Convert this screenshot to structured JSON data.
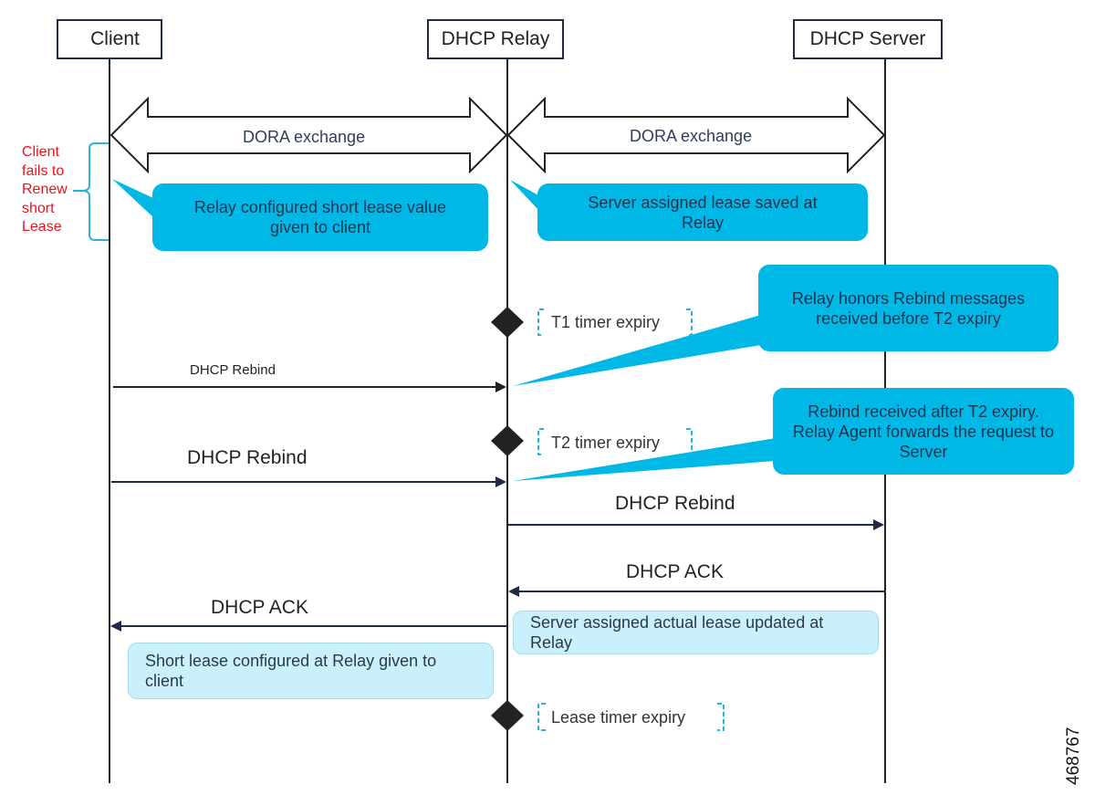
{
  "actors": {
    "client": "Client",
    "relay": "DHCP Relay",
    "server": "DHCP Server"
  },
  "exchanges": {
    "client_relay": "DORA exchange",
    "relay_server": "DORA exchange"
  },
  "side_note": {
    "lines": [
      "Client",
      "fails to",
      "Renew",
      "short",
      "Lease"
    ],
    "color": "#e8141b"
  },
  "callouts": {
    "relay_short_lease": "Relay configured short lease value given to client",
    "server_lease_saved": "Server assigned lease saved at Relay",
    "relay_honors_rebind": "Relay honors Rebind messages received before T2 expiry",
    "rebind_after_t2": "Rebind received after T2 expiry. Relay Agent forwards the request to Server",
    "server_lease_updated": "Server assigned actual lease updated at Relay",
    "short_lease_given": "Short lease configured at Relay given to client"
  },
  "timers": {
    "t1": "T1 timer expiry",
    "t2": "T2 timer expiry",
    "lease": "Lease timer expiry"
  },
  "messages": [
    {
      "label": "DHCP Rebind",
      "from": "Client",
      "to": "DHCP Relay"
    },
    {
      "label": "DHCP Rebind",
      "from": "Client",
      "to": "DHCP Relay"
    },
    {
      "label": "DHCP Rebind",
      "from": "DHCP Relay",
      "to": "DHCP Server"
    },
    {
      "label": "DHCP ACK",
      "from": "DHCP Server",
      "to": "DHCP Relay"
    },
    {
      "label": "DHCP ACK",
      "from": "DHCP Relay",
      "to": "Client"
    }
  ],
  "figure_id": "468767",
  "colors": {
    "callout_dark": "#00b8e6",
    "callout_light": "#c9f0fb",
    "bracket": "#2ab3d9",
    "line": "#1f2a44"
  }
}
